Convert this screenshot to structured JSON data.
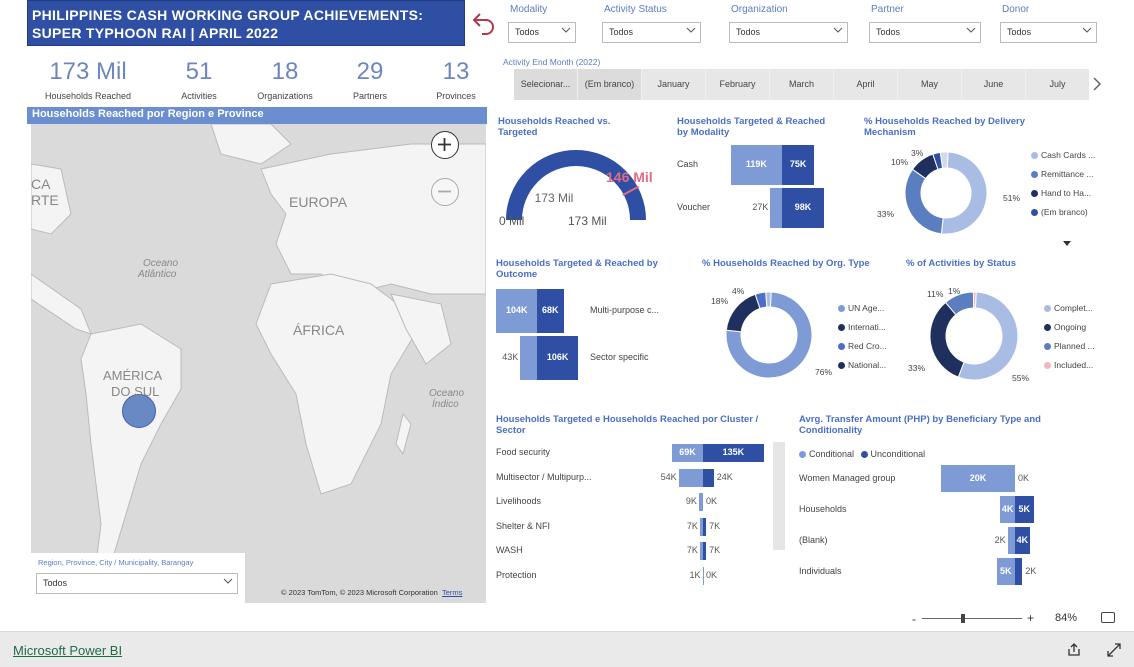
{
  "banner": {
    "line1": "PHILIPPINES CASH WORKING GROUP ACHIEVEMENTS:",
    "line2": "SUPER TYPHOON RAI | APRIL 2022"
  },
  "filters": [
    {
      "label": "Modality",
      "value": "Todos"
    },
    {
      "label": "Activity Status",
      "value": "Todos"
    },
    {
      "label": "Organization",
      "value": "Todos"
    },
    {
      "label": "Partner",
      "value": "Todos"
    },
    {
      "label": "Donor",
      "value": "Todos"
    }
  ],
  "kpis": [
    {
      "value": "173 Mil",
      "label": "Households Reached"
    },
    {
      "value": "51",
      "label": "Activities"
    },
    {
      "value": "18",
      "label": "Organizations"
    },
    {
      "value": "29",
      "label": "Partners"
    },
    {
      "value": "13",
      "label": "Provinces"
    }
  ],
  "month_slicer": {
    "label": "Activity End Month (2022)",
    "items": [
      "Selecionar...",
      "(Em branco)",
      "January",
      "February",
      "March",
      "April",
      "May",
      "June",
      "July"
    ]
  },
  "map": {
    "title": "Households Reached por Region e Province",
    "labels": {
      "europa": "EUROPA",
      "africa": "ÁFRICA",
      "america1": "AMÉRICA",
      "america2": "DO SUL",
      "atl1": "Oceano",
      "atl2": "Atlântico",
      "ind1": "Oceano",
      "ind2": "Índico",
      "ca1": "CA",
      "ca2": "RTE"
    },
    "copyright": "© 2023 TomTom, © 2023 Microsoft Corporation",
    "terms": "Terms",
    "region_slicer_label": "Region, Province, City / Municipality, Barangay",
    "region_slicer_value": "Todos"
  },
  "gauge": {
    "title": "Households Reached vs. Targeted",
    "center": "173 Mil",
    "min": "0 Mil",
    "max": "173 Mil",
    "target": "146 Mil",
    "value": 173,
    "target_value": 146,
    "max_value": 173,
    "color": "#2e4fa3",
    "target_color": "#e06c83"
  },
  "modality": {
    "title": "Households Targeted & Reached by Modality",
    "rows": [
      {
        "name": "Cash",
        "targeted": "119K",
        "reached": "75K",
        "t": 119,
        "r": 75
      },
      {
        "name": "Voucher",
        "targeted": "27K",
        "reached": "98K",
        "t": 27,
        "r": 98
      }
    ]
  },
  "delivery": {
    "title": "% Households Reached by Delivery Mechanism",
    "legend": [
      "Cash Cards ...",
      "Remittance ...",
      "Hand to Ha...",
      "(Em branco)"
    ],
    "labels": {
      "a": "3%",
      "b": "10%",
      "c": "51%",
      "d": "33%"
    },
    "values": [
      51,
      33,
      10,
      3,
      3
    ],
    "colors": [
      "#a9bde4",
      "#5b7ec1",
      "#1f2f5e",
      "#2e4fa3",
      "#cfd9ef"
    ]
  },
  "outcome": {
    "title": "Households Targeted & Reached by Outcome",
    "rows": [
      {
        "name": "Multi-purpose c...",
        "targeted": "104K",
        "reached": "68K",
        "t": 104,
        "r": 68
      },
      {
        "name": "Sector specific",
        "targeted": "43K",
        "reached": "106K",
        "t": 43,
        "r": 106
      }
    ]
  },
  "orgtype": {
    "title": "% Households Reached by Org. Type",
    "legend": [
      "UN Age...",
      "Internati...",
      "Red Cro...",
      "National..."
    ],
    "labels": {
      "a": "4%",
      "b": "18%",
      "c": "76%"
    },
    "values": [
      76,
      18,
      4,
      2
    ],
    "colors": [
      "#7f9bd6",
      "#1f2f5e",
      "#4a6fc6",
      "#a9bde4"
    ]
  },
  "status": {
    "title": "% of Activities by Status",
    "legend": [
      "Complet...",
      "Ongoing",
      "Planned ...",
      "Included..."
    ],
    "labels": {
      "a": "1%",
      "b": "11%",
      "c": "33%",
      "d": "55%"
    },
    "values": [
      55,
      33,
      11,
      1
    ],
    "colors": [
      "#a9bde4",
      "#1f2f5e",
      "#5b7ec1",
      "#f0b5c0"
    ]
  },
  "cluster": {
    "title": "Households Targeted e Households Reached por Cluster / Sector",
    "rows": [
      {
        "name": "Food security",
        "targeted": "69K",
        "reached": "135K",
        "t": 69,
        "r": 135
      },
      {
        "name": "Multisector / Multipurp...",
        "targeted": "54K",
        "reached": "24K",
        "t": 54,
        "r": 24
      },
      {
        "name": "Livelihoods",
        "targeted": "9K",
        "reached": "0K",
        "t": 9,
        "r": 0
      },
      {
        "name": "Shelter & NFI",
        "targeted": "7K",
        "reached": "7K",
        "t": 7,
        "r": 7
      },
      {
        "name": "WASH",
        "targeted": "7K",
        "reached": "7K",
        "t": 7,
        "r": 7
      },
      {
        "name": "Protection",
        "targeted": "1K",
        "reached": "0K",
        "t": 1,
        "r": 0
      }
    ]
  },
  "transfer": {
    "title": "Avrg. Transfer Amount (PHP) by Beneficiary Type and Conditionality",
    "legend": [
      "Conditional",
      "Unconditional"
    ],
    "rows": [
      {
        "name": "Women Managed group",
        "cond": "20K",
        "uncond": "0K",
        "c": 20,
        "u": 0
      },
      {
        "name": "Households",
        "cond": "4K",
        "uncond": "5K",
        "c": 4,
        "u": 5
      },
      {
        "name": "(Blank)",
        "cond": "2K",
        "uncond": "4K",
        "c": 2,
        "u": 4
      },
      {
        "name": "Individuals",
        "cond": "5K",
        "uncond": "2K",
        "c": 5,
        "u": 2
      }
    ]
  },
  "zoom": {
    "minus": "-",
    "plus": "+",
    "level": "84%"
  },
  "footer": {
    "brand": "Microsoft Power BI"
  }
}
